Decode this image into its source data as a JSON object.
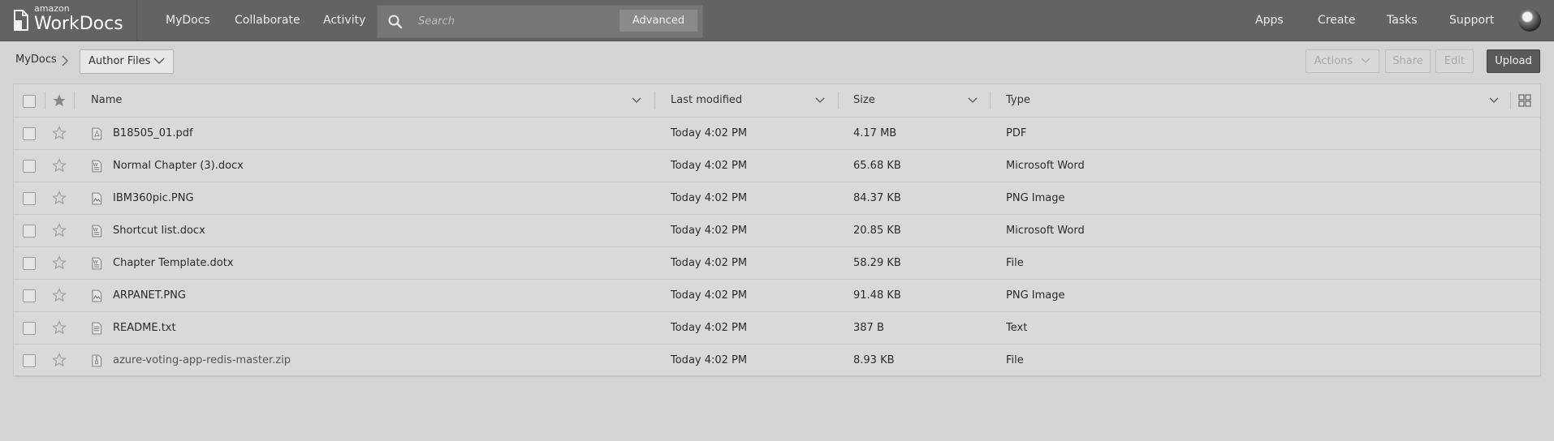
{
  "app": {
    "logo_small": "amazon",
    "logo_big": "WorkDocs",
    "nav": [
      "MyDocs",
      "Collaborate",
      "Activity"
    ],
    "search": {
      "placeholder": "Search",
      "advanced_label": "Advanced"
    },
    "right_nav": [
      "Apps",
      "Create",
      "Tasks",
      "Support"
    ]
  },
  "breadcrumb": {
    "root": "MyDocs",
    "current_folder": "Author Files"
  },
  "toolbar": {
    "actions_label": "Actions",
    "share_label": "Share",
    "edit_label": "Edit",
    "upload_label": "Upload"
  },
  "table": {
    "columns": [
      "Name",
      "Last modified",
      "Size",
      "Type"
    ],
    "rows": [
      {
        "name": "B18505_01.pdf",
        "modified": "Today 4:02 PM",
        "size": "4.17 MB",
        "type": "PDF",
        "icon": "pdf-file-icon"
      },
      {
        "name": "Normal Chapter (3).docx",
        "modified": "Today 4:02 PM",
        "size": "65.68 KB",
        "type": "Microsoft Word",
        "icon": "word-file-icon"
      },
      {
        "name": "IBM360pic.PNG",
        "modified": "Today 4:02 PM",
        "size": "84.37 KB",
        "type": "PNG Image",
        "icon": "image-file-icon"
      },
      {
        "name": "Shortcut list.docx",
        "modified": "Today 4:02 PM",
        "size": "20.85 KB",
        "type": "Microsoft Word",
        "icon": "word-file-icon"
      },
      {
        "name": "Chapter Template.dotx",
        "modified": "Today 4:02 PM",
        "size": "58.29 KB",
        "type": "File",
        "icon": "word-file-icon"
      },
      {
        "name": "ARPANET.PNG",
        "modified": "Today 4:02 PM",
        "size": "91.48 KB",
        "type": "PNG Image",
        "icon": "image-file-icon"
      },
      {
        "name": "README.txt",
        "modified": "Today 4:02 PM",
        "size": "387 B",
        "type": "Text",
        "icon": "text-file-icon"
      },
      {
        "name": "azure-voting-app-redis-master.zip",
        "modified": "Today 4:02 PM",
        "size": "8.93 KB",
        "type": "File",
        "icon": "zip-file-icon"
      }
    ]
  }
}
